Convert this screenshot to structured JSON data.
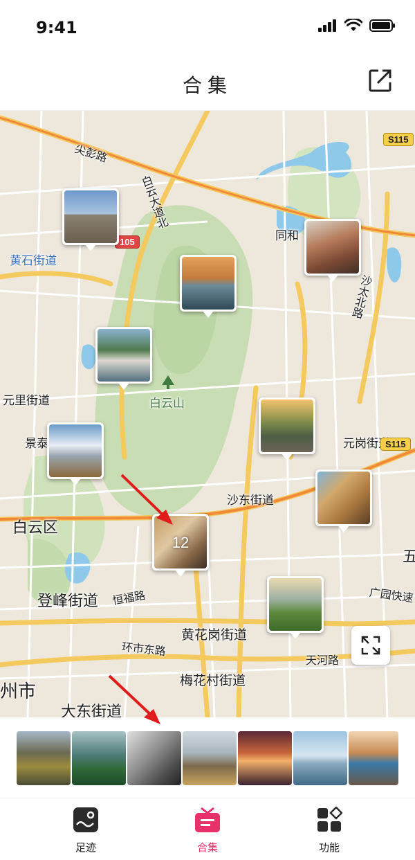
{
  "status": {
    "time": "9:41"
  },
  "header": {
    "title": "合集"
  },
  "map": {
    "labels": {
      "jianpeng": "尖彭路",
      "baiyun_avenue": "白云大道北",
      "huangshi": "黄石街道",
      "tonghe": "同和",
      "shatai": "沙太北路",
      "yuanli": "元里街道",
      "jingtai": "景泰",
      "baiyunshan": "白云山",
      "yuangang": "元岗街道",
      "shadong": "沙东街道",
      "baiyunqu": "白云区",
      "dengfeng": "登峰街道",
      "hengfu": "恒福路",
      "guangyuan": "广园快速",
      "wu": "五",
      "huanghuagang": "黄花岗街道",
      "huanshi": "环市东路",
      "tianhe": "天河路",
      "meihuacun": "梅花村街道",
      "city": "州市",
      "dadong": "大东街道",
      "s115": "S115",
      "road105": "105"
    },
    "cluster_count": "12"
  },
  "tabs": [
    {
      "label": "足迹"
    },
    {
      "label": "合集"
    },
    {
      "label": "功能"
    }
  ],
  "colors": {
    "accent": "#e8306a",
    "water": "#8ec9ea",
    "park": "#c9ddb4",
    "road": "#f4c95d"
  }
}
